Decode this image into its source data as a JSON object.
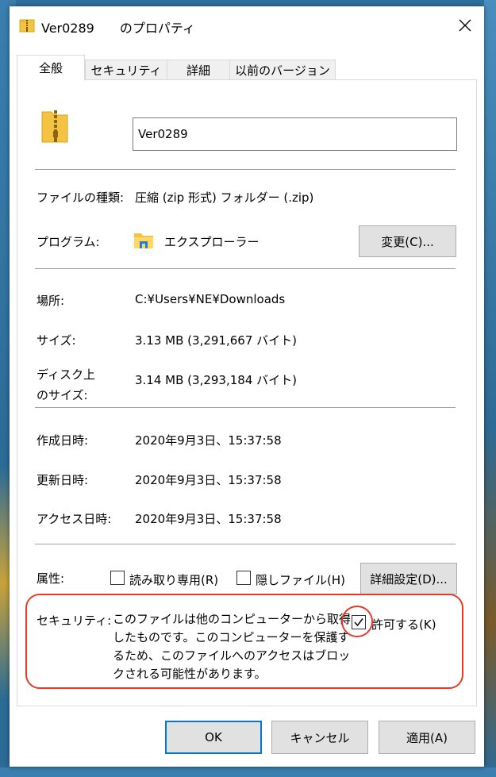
{
  "window": {
    "title": "Ver0289　　のプロパティ"
  },
  "tabs": [
    {
      "label": "全般"
    },
    {
      "label": "セキュリティ"
    },
    {
      "label": "詳細"
    },
    {
      "label": "以前のバージョン"
    }
  ],
  "general": {
    "name_value": "Ver0289",
    "file_type_label": "ファイルの種類:",
    "file_type_value": "圧縮 (zip 形式) フォルダー (.zip)",
    "program_label": "プログラム:",
    "program_value": "エクスプローラー",
    "change_button": "変更(C)...",
    "location_label": "場所:",
    "location_value": "C:¥Users¥NE¥Downloads",
    "size_label": "サイズ:",
    "size_value": "3.13 MB (3,291,667 バイト)",
    "disk_size_label_line1": "ディスク上",
    "disk_size_label_line2": "のサイズ:",
    "disk_size_value": "3.14 MB (3,293,184 バイト)",
    "created_label": "作成日時:",
    "created_value": "2020年9月3日、15:37:58",
    "modified_label": "更新日時:",
    "modified_value": "2020年9月3日、15:37:58",
    "accessed_label": "アクセス日時:",
    "accessed_value": "2020年9月3日、15:37:58",
    "attributes_label": "属性:",
    "readonly_label": "読み取り専用(R)",
    "hidden_label": "隠しファイル(H)",
    "advanced_button": "詳細設定(D)...",
    "security_label": "セキュリティ:",
    "security_text": "このファイルは他のコンピューターから取得したものです。このコンピューターを保護するため、このファイルへのアクセスはブロックされる可能性があります。",
    "unblock_label": "許可する(K)"
  },
  "checkboxes": {
    "readonly": false,
    "hidden": false,
    "unblock": true
  },
  "buttons": {
    "ok": "OK",
    "cancel": "キャンセル",
    "apply": "適用(A)"
  },
  "colors": {
    "highlight_ring": "#e53c2a",
    "default_button_border": "#0078d7",
    "folder_yellow": "#f5c342"
  }
}
